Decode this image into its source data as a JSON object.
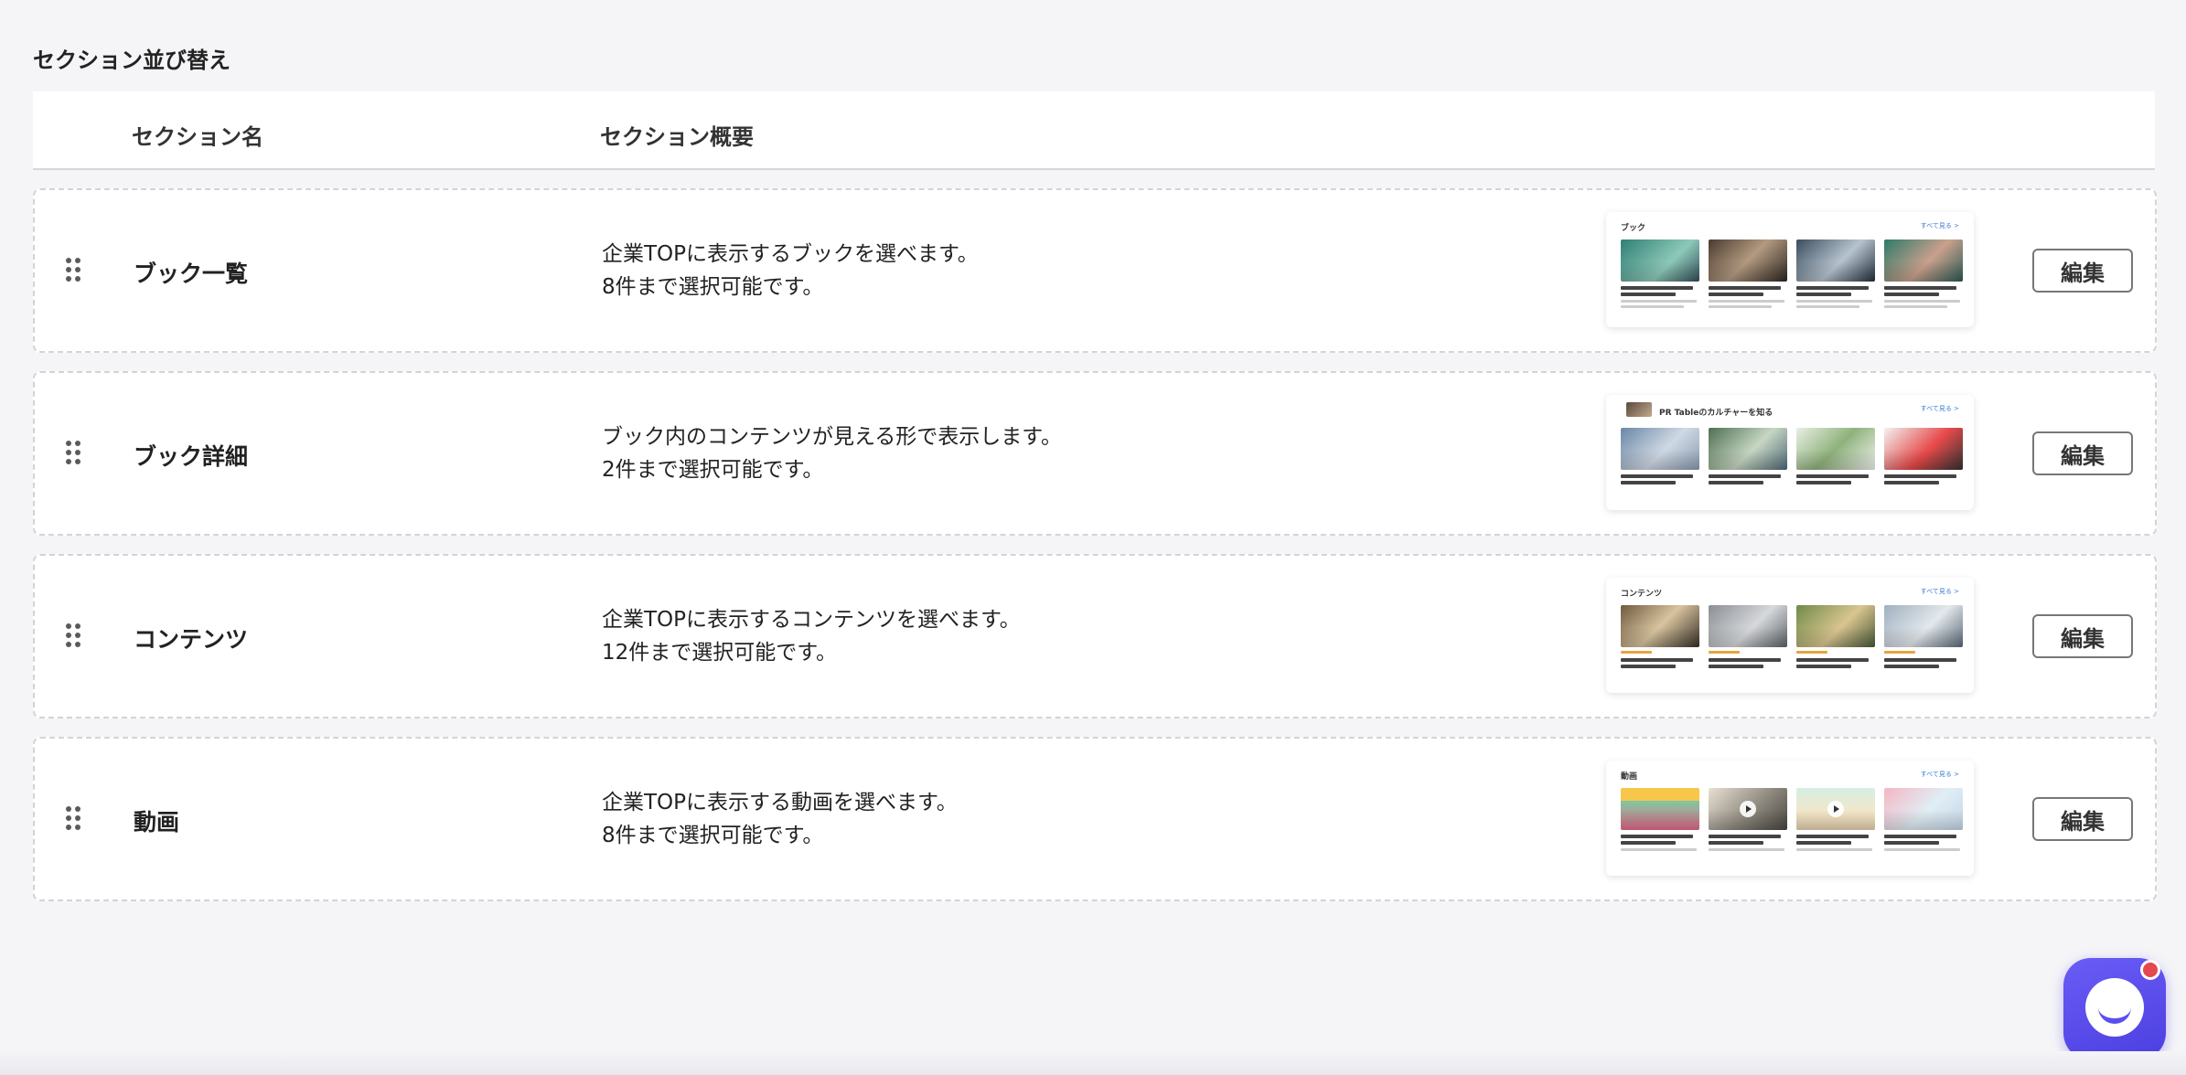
{
  "page": {
    "title": "セクション並び替え"
  },
  "table": {
    "headers": {
      "name": "セクション名",
      "description": "セクション概要"
    }
  },
  "rows": [
    {
      "name": "ブック一覧",
      "description": [
        "企業TOPに表示するブックを選べます。",
        "8件まで選択可能です。"
      ],
      "edit_label": "編集",
      "preview": {
        "title": "ブック",
        "more": "すべて見る >",
        "kind": "book"
      }
    },
    {
      "name": "ブック詳細",
      "description": [
        "ブック内のコンテンツが見える形で表示します。",
        "2件まで選択可能です。"
      ],
      "edit_label": "編集",
      "preview": {
        "title": "PR Tableのカルチャーを知る",
        "more": "すべて見る >",
        "kind": "book-detail"
      }
    },
    {
      "name": "コンテンツ",
      "description": [
        "企業TOPに表示するコンテンツを選べます。",
        "12件まで選択可能です。"
      ],
      "edit_label": "編集",
      "preview": {
        "title": "コンテンツ",
        "more": "すべて見る >",
        "kind": "contents"
      }
    },
    {
      "name": "動画",
      "description": [
        "企業TOPに表示する動画を選べます。",
        "8件まで選択可能です。"
      ],
      "edit_label": "編集",
      "preview": {
        "title": "動画",
        "more": "すべて見る >",
        "kind": "video"
      }
    }
  ],
  "colors": {
    "background": "#f5f5f8",
    "accent": "#5a4ef0",
    "badge": "#e5484d",
    "link": "#3a7bd5"
  },
  "icons": {
    "drag_handle": "drag-handle-icon",
    "chat": "chat-icon"
  }
}
